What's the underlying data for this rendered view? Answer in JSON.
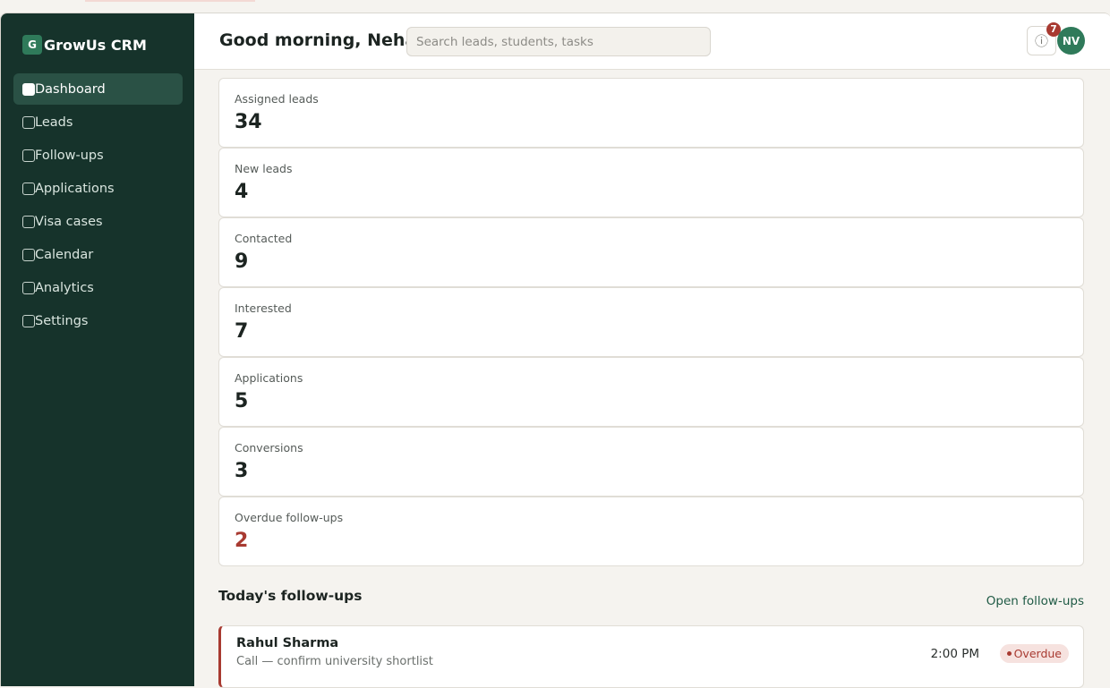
{
  "app": {
    "brand_initial": "G",
    "brand_name": "GrowUs CRM"
  },
  "sidebar": {
    "items": [
      {
        "label": "Dashboard",
        "active": true
      },
      {
        "label": "Leads"
      },
      {
        "label": "Follow-ups"
      },
      {
        "label": "Applications"
      },
      {
        "label": "Visa cases"
      },
      {
        "label": "Calendar"
      },
      {
        "label": "Analytics"
      },
      {
        "label": "Settings"
      }
    ]
  },
  "header": {
    "greeting": "Good morning, Neha",
    "search_placeholder": "Search leads, students, tasks",
    "info_icon": "ⓘ",
    "notification_count": "7",
    "avatar_initials": "NV"
  },
  "stats": [
    {
      "label": "Assigned leads",
      "value": "34"
    },
    {
      "label": "New leads",
      "value": "4"
    },
    {
      "label": "Contacted",
      "value": "9"
    },
    {
      "label": "Interested",
      "value": "7"
    },
    {
      "label": "Applications",
      "value": "5"
    },
    {
      "label": "Conversions",
      "value": "3"
    },
    {
      "label": "Overdue follow-ups",
      "value": "2",
      "alert": true
    }
  ],
  "followups": {
    "title": "Today's follow-ups",
    "link_label": "Open follow-ups",
    "items": [
      {
        "name": "Rahul Sharma",
        "task": "Call — confirm university shortlist",
        "time": "2:00 PM",
        "status": "Overdue"
      }
    ]
  },
  "colors": {
    "sidebar_bg": "#16332b",
    "accent": "#2f7a5a",
    "alert": "#a83a31"
  }
}
